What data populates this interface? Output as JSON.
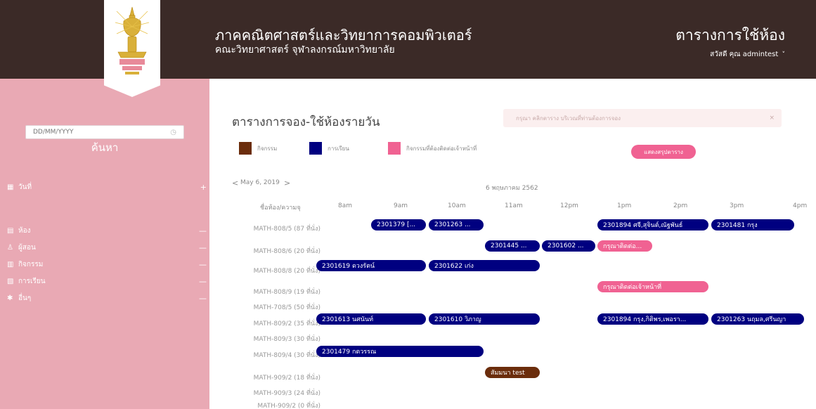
{
  "header": {
    "department_title": "ภาคคณิตศาสตร์และวิทยาการคอมพิวเตอร์",
    "faculty_subtitle": "คณะวิทยาศาสตร์ จุฬาลงกรณ์มหาวิทยาลัย",
    "app_title": "ตารางการใช้ห้อง",
    "user_greeting": "สวัสดี คุณ admintest",
    "user_chevron": "˅"
  },
  "sidebar": {
    "search_title": "ค้นหา",
    "date_placeholder": "DD/MM/YYYY",
    "filters": [
      {
        "label": "วันที่",
        "icon": "calendar-icon",
        "toggle": "+"
      },
      {
        "label": "ห้อง",
        "icon": "grid-icon",
        "toggle": "—"
      },
      {
        "label": "ผู้สอน",
        "icon": "user-icon",
        "toggle": "—"
      },
      {
        "label": "กิจกรรม",
        "icon": "activity-icon",
        "toggle": "—"
      },
      {
        "label": "การเรียน",
        "icon": "book-icon",
        "toggle": "—"
      },
      {
        "label": "อื่นๆ",
        "icon": "more-icon",
        "toggle": "—"
      }
    ]
  },
  "main": {
    "title": "ตารางการจอง-ใช้ห้องรายวัน",
    "instruction": "กรุณา คลิกตาราง บริเวณที่ท่านต้องการจอง",
    "instruction_close": "×",
    "legend": [
      {
        "label": "กิจกรรม",
        "color": "#6b2d0c"
      },
      {
        "label": "การเรียน",
        "color": "#000080"
      },
      {
        "label": "กิจกรรมที่ต้องติดต่อเจ้าหน้าที่",
        "color": "#f06292"
      }
    ],
    "summary_button": "แสดงสรุปตาราง",
    "nav": {
      "prev": "<",
      "date": "May 6, 2019",
      "next": ">"
    },
    "thai_date": "6 พฤษภาคม 2562",
    "room_header": "ชื่อห้อง/ความจุ",
    "times": [
      "8am",
      "9am",
      "10am",
      "11am",
      "12pm",
      "1pm",
      "2pm",
      "3pm",
      "4pm"
    ],
    "rooms": [
      "MATH-808/5 (87 ที่นั่ง)",
      "MATH-808/6 (20 ที่นั่ง)",
      "MATH-808/8 (20 ที่นั่ง)",
      "MATH-808/9 (19 ที่นั่ง)",
      "MATH-708/5 (50 ที่นั่ง)",
      "MATH-809/2 (35 ที่นั่ง)",
      "MATH-809/3 (30 ที่นั่ง)",
      "MATH-809/4 (30 ที่นั่ง)",
      "MATH-909/2 (18 ที่นั่ง)",
      "MATH-909/3 (24 ที่นั่ง)",
      "MATH-909/2 (0 ที่นั่ง)"
    ],
    "events": [
      {
        "label": "2301379 [...",
        "type": "class"
      },
      {
        "label": "2301263 ...",
        "type": "class"
      },
      {
        "label": "2301894 ศจี,สุจินต์,ณัฐพันธ์",
        "type": "class"
      },
      {
        "label": "2301481 กรุง",
        "type": "class"
      },
      {
        "label": "2301445 ...",
        "type": "class"
      },
      {
        "label": "2301602 ...",
        "type": "class"
      },
      {
        "label": "กรุณาติดต่อ...",
        "type": "cancel"
      },
      {
        "label": "2301619 ดวงรัตน์",
        "type": "class"
      },
      {
        "label": "2301622 เก่ง",
        "type": "class"
      },
      {
        "label": "กรุณาติดต่อเจ้าหน้าที่",
        "type": "cancel"
      },
      {
        "label": "2301613 นศนันท์",
        "type": "class"
      },
      {
        "label": "2301610 วิภาญ",
        "type": "class"
      },
      {
        "label": "2301894 กรุง,กิติพร,เพอรา...",
        "type": "class"
      },
      {
        "label": "2301263 นฤมล,ศรีนญา",
        "type": "class"
      },
      {
        "label": "2301479 กตวรรณ",
        "type": "class"
      },
      {
        "label": "สัมมนา test",
        "type": "activity"
      }
    ]
  }
}
